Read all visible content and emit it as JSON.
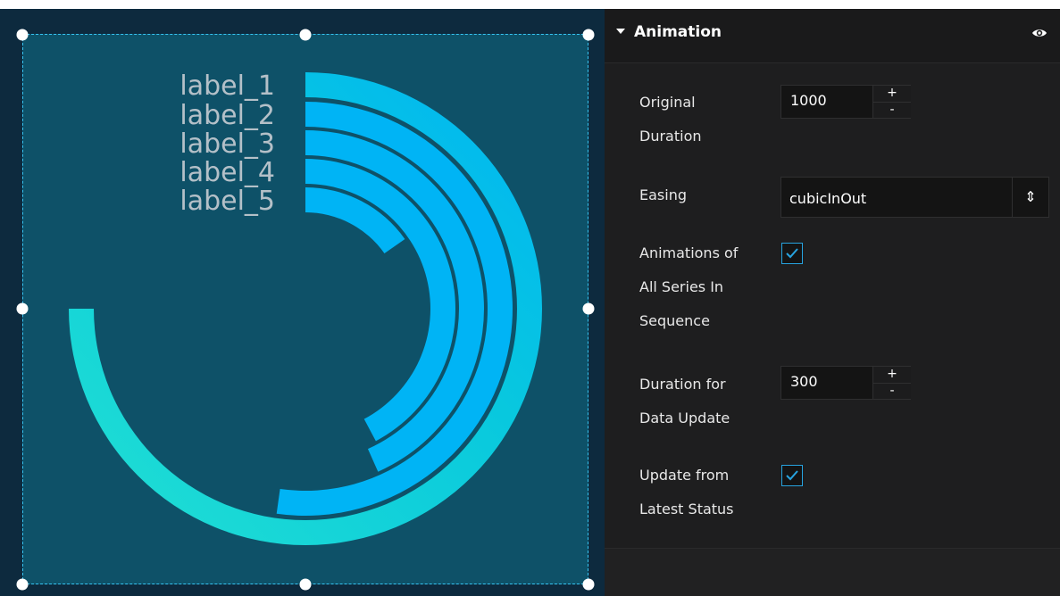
{
  "chart_data": {
    "type": "radial-bar",
    "categories": [
      "label_1",
      "label_2",
      "label_3",
      "label_4",
      "label_5"
    ],
    "values": [
      270,
      188,
      156,
      152,
      55
    ],
    "max_angle": 360,
    "colors": [
      "#27d8d6",
      "#00b4f5",
      "#00b4f5",
      "#00b4f5",
      "#00b4f5"
    ]
  },
  "panel": {
    "section_title": "Animation",
    "original_duration_label_1": "Original",
    "original_duration_label_2": "Duration",
    "original_duration_value": "1000",
    "easing_label": "Easing",
    "easing_value": "cubicInOut",
    "sequence_label_1": "Animations of",
    "sequence_label_2": "All Series In",
    "sequence_label_3": "Sequence",
    "sequence_checked": true,
    "update_duration_label_1": "Duration for",
    "update_duration_label_2": "Data Update",
    "update_duration_value": "300",
    "latest_status_label_1": "Update from",
    "latest_status_label_2": "Latest Status",
    "latest_status_checked": true,
    "stepper_plus": "+",
    "stepper_minus": "-",
    "select_arrows": "⇕"
  },
  "icons": {
    "collapse": "caret-down-icon",
    "visibility": "eye-icon",
    "checkmark": "check-icon",
    "select": "up-down-arrows-icon"
  }
}
